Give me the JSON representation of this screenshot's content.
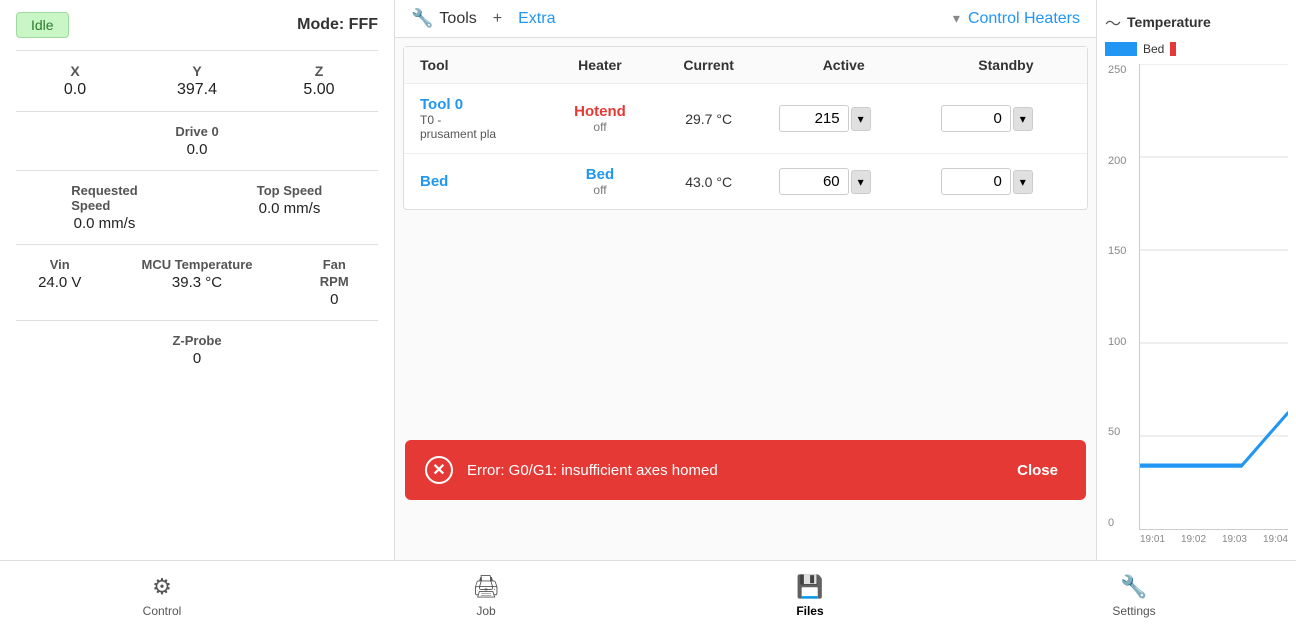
{
  "status": {
    "badge": "Idle",
    "mode": "Mode: FFF"
  },
  "coords": {
    "x_label": "X",
    "y_label": "Y",
    "z_label": "Z",
    "x_value": "0.0",
    "y_value": "397.4",
    "z_value": "5.00"
  },
  "drive": {
    "label": "Drive 0",
    "value": "0.0"
  },
  "speed": {
    "requested_label": "Requested",
    "speed_label": "Speed",
    "requested_value": "0.0 mm/s",
    "top_speed_label": "Top Speed",
    "top_speed_value": "0.0 mm/s"
  },
  "vin": {
    "label": "Vin",
    "value": "24.0 V"
  },
  "mcu": {
    "label": "MCU Temperature",
    "value": "39.3 °C"
  },
  "fan": {
    "label": "Fan",
    "rpm_label": "RPM",
    "value": "0"
  },
  "zprobe": {
    "label": "Z-Probe",
    "value": "0"
  },
  "toolbar": {
    "tools_label": "Tools",
    "extra_label": "Extra",
    "control_heaters_label": "Control Heaters"
  },
  "heaters_table": {
    "col_tool": "Tool",
    "col_heater": "Heater",
    "col_current": "Current",
    "col_active": "Active",
    "col_standby": "Standby",
    "rows": [
      {
        "tool_name": "Tool 0",
        "tool_desc_line1": "T0 -",
        "tool_desc_line2": "prusament pla",
        "heater_name": "Hotend",
        "heater_status": "off",
        "current_temp": "29.7 °C",
        "active_value": "215",
        "standby_value": "0"
      },
      {
        "tool_name": "Bed",
        "tool_desc_line1": "",
        "tool_desc_line2": "",
        "heater_name": "Bed",
        "heater_status": "off",
        "current_temp": "43.0 °C",
        "active_value": "60",
        "standby_value": "0"
      }
    ]
  },
  "error": {
    "message": "Error: G0/G1: insufficient axes homed",
    "close_label": "Close"
  },
  "chart": {
    "title": "Temperature",
    "legend_bed_label": "Bed",
    "y_labels": [
      "250",
      "200",
      "150",
      "100",
      "50",
      "0"
    ],
    "x_labels": [
      "19:01",
      "19:02",
      "19:03",
      "19:04"
    ]
  },
  "bottom_nav": {
    "items": [
      {
        "label": "Control",
        "icon": "⚙"
      },
      {
        "label": "Job",
        "icon": "🖨"
      },
      {
        "label": "Files",
        "icon": "💾"
      },
      {
        "label": "Settings",
        "icon": "🔧"
      }
    ],
    "active_index": 2
  }
}
